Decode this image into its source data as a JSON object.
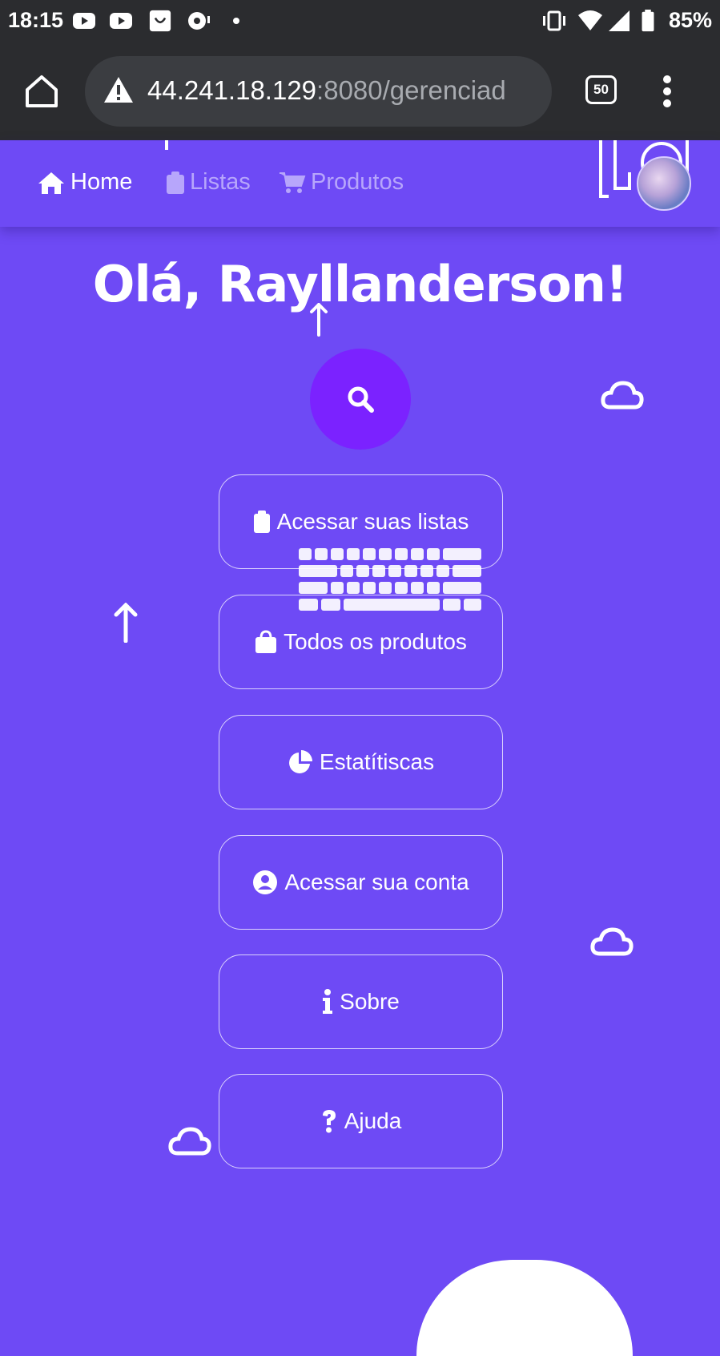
{
  "status_bar": {
    "time": "18:15",
    "battery": "85%"
  },
  "browser": {
    "url_host": "44.241.18.129",
    "url_rest": ":8080/gerenciad",
    "tab_count": "50"
  },
  "nav": {
    "home": "Home",
    "listas": "Listas",
    "produtos": "Produtos"
  },
  "greeting": "Olá, Rayllanderson!",
  "menu": [
    {
      "label": "Acessar suas listas",
      "icon": "clipboard-icon"
    },
    {
      "label": "Todos os produtos",
      "icon": "shopping-bag-icon"
    },
    {
      "label": "Estatítiscas",
      "icon": "pie-chart-icon"
    },
    {
      "label": "Acessar sua conta",
      "icon": "user-circle-icon"
    },
    {
      "label": "Sobre",
      "icon": "info-icon"
    },
    {
      "label": "Ajuda",
      "icon": "question-icon"
    }
  ],
  "colors": {
    "background": "#6e4af5",
    "search_button": "#7b22ff",
    "browser_chrome": "#2b2c2f"
  }
}
